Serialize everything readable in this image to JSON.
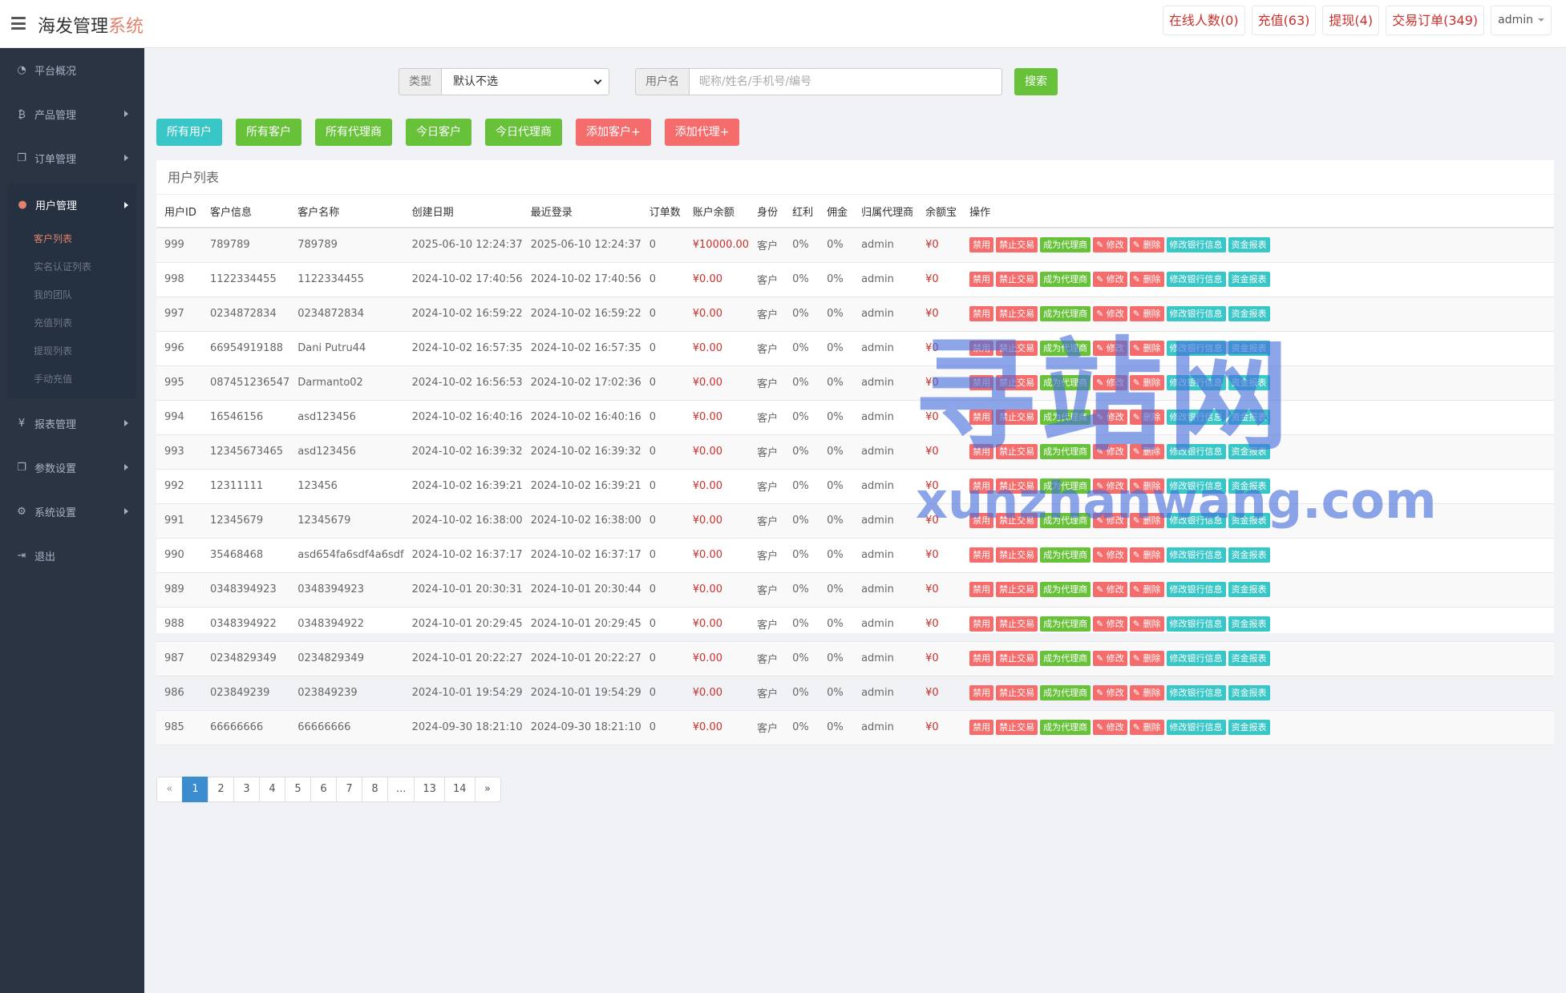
{
  "header": {
    "brand_main": "海发管理",
    "brand_accent": "系统",
    "pills": [
      "在线人数(0)",
      "充值(63)",
      "提现(4)",
      "交易订单(349)"
    ],
    "admin_label": "admin"
  },
  "sidebar": {
    "items": [
      {
        "label": "平台概况",
        "icon": "dashboard-icon",
        "glyph": "◔"
      },
      {
        "label": "产品管理",
        "icon": "bitcoin-icon",
        "glyph": "₿"
      },
      {
        "label": "订单管理",
        "icon": "copy-icon",
        "glyph": "❐"
      }
    ],
    "active": {
      "label": "用户管理",
      "icon": "user-icon",
      "glyph": "●"
    },
    "sub_items": [
      "客户列表",
      "实名认证列表",
      "我的团队",
      "充值列表",
      "提现列表",
      "手动充值"
    ],
    "items_after": [
      {
        "label": "报表管理",
        "icon": "yen-icon",
        "glyph": "¥"
      },
      {
        "label": "参数设置",
        "icon": "copy-icon",
        "glyph": "❐"
      },
      {
        "label": "系统设置",
        "icon": "gears-icon",
        "glyph": "⚙"
      },
      {
        "label": "退出",
        "icon": "sign-out-icon",
        "glyph": "⇥"
      }
    ]
  },
  "search": {
    "type_label": "类型",
    "type_value": "默认不选",
    "user_label": "用户名",
    "user_placeholder": "昵称/姓名/手机号/编号",
    "search_button": "搜索"
  },
  "filters": [
    {
      "label": "所有用户",
      "color": "teal"
    },
    {
      "label": "所有客户",
      "color": "green"
    },
    {
      "label": "所有代理商",
      "color": "green"
    },
    {
      "label": "今日客户",
      "color": "green"
    },
    {
      "label": "今日代理商",
      "color": "green"
    },
    {
      "label": "添加客户+",
      "color": "red"
    },
    {
      "label": "添加代理+",
      "color": "red"
    }
  ],
  "panel_title": "用户列表",
  "table": {
    "columns": [
      "用户ID",
      "客户信息",
      "客户名称",
      "创建日期",
      "最近登录",
      "订单数",
      "账户余额",
      "身份",
      "红利",
      "佣金",
      "归属代理商",
      "余额宝",
      "操作"
    ],
    "actions": [
      {
        "label": "禁用",
        "color": "red"
      },
      {
        "label": "禁止交易",
        "color": "red"
      },
      {
        "label": "成为代理商",
        "color": "green"
      },
      {
        "label": "✎ 修改",
        "color": "red"
      },
      {
        "label": "✎ 删除",
        "color": "red"
      },
      {
        "label": "修改银行信息",
        "color": "teal"
      },
      {
        "label": "资金报表",
        "color": "teal"
      }
    ],
    "rows": [
      [
        "999",
        "789789",
        "789789",
        "2025-06-10 12:24:37",
        "2025-06-10 12:24:37",
        "0",
        "¥10000.00",
        "客户",
        "0%",
        "0%",
        "admin",
        "¥0"
      ],
      [
        "998",
        "1122334455",
        "1122334455",
        "2024-10-02 17:40:56",
        "2024-10-02 17:40:56",
        "0",
        "¥0.00",
        "客户",
        "0%",
        "0%",
        "admin",
        "¥0"
      ],
      [
        "997",
        "0234872834",
        "0234872834",
        "2024-10-02 16:59:22",
        "2024-10-02 16:59:22",
        "0",
        "¥0.00",
        "客户",
        "0%",
        "0%",
        "admin",
        "¥0"
      ],
      [
        "996",
        "66954919188",
        "Dani Putru44",
        "2024-10-02 16:57:35",
        "2024-10-02 16:57:35",
        "0",
        "¥0.00",
        "客户",
        "0%",
        "0%",
        "admin",
        "¥0"
      ],
      [
        "995",
        "087451236547",
        "Darmanto02",
        "2024-10-02 16:56:53",
        "2024-10-02 17:02:36",
        "0",
        "¥0.00",
        "客户",
        "0%",
        "0%",
        "admin",
        "¥0"
      ],
      [
        "994",
        "16546156",
        "asd123456",
        "2024-10-02 16:40:16",
        "2024-10-02 16:40:16",
        "0",
        "¥0.00",
        "客户",
        "0%",
        "0%",
        "admin",
        "¥0"
      ],
      [
        "993",
        "12345673465",
        "asd123456",
        "2024-10-02 16:39:32",
        "2024-10-02 16:39:32",
        "0",
        "¥0.00",
        "客户",
        "0%",
        "0%",
        "admin",
        "¥0"
      ],
      [
        "992",
        "12311111",
        "123456",
        "2024-10-02 16:39:21",
        "2024-10-02 16:39:21",
        "0",
        "¥0.00",
        "客户",
        "0%",
        "0%",
        "admin",
        "¥0"
      ],
      [
        "991",
        "12345679",
        "12345679",
        "2024-10-02 16:38:00",
        "2024-10-02 16:38:00",
        "0",
        "¥0.00",
        "客户",
        "0%",
        "0%",
        "admin",
        "¥0"
      ],
      [
        "990",
        "35468468",
        "asd654fa6sdf4a6sdf",
        "2024-10-02 16:37:17",
        "2024-10-02 16:37:17",
        "0",
        "¥0.00",
        "客户",
        "0%",
        "0%",
        "admin",
        "¥0"
      ],
      [
        "989",
        "0348394923",
        "0348394923",
        "2024-10-01 20:30:31",
        "2024-10-01 20:30:44",
        "0",
        "¥0.00",
        "客户",
        "0%",
        "0%",
        "admin",
        "¥0"
      ],
      [
        "988",
        "0348394922",
        "0348394922",
        "2024-10-01 20:29:45",
        "2024-10-01 20:29:45",
        "0",
        "¥0.00",
        "客户",
        "0%",
        "0%",
        "admin",
        "¥0"
      ],
      [
        "987",
        "0234829349",
        "0234829349",
        "2024-10-01 20:22:27",
        "2024-10-01 20:22:27",
        "0",
        "¥0.00",
        "客户",
        "0%",
        "0%",
        "admin",
        "¥0"
      ],
      [
        "986",
        "023849239",
        "023849239",
        "2024-10-01 19:54:29",
        "2024-10-01 19:54:29",
        "0",
        "¥0.00",
        "客户",
        "0%",
        "0%",
        "admin",
        "¥0"
      ],
      [
        "985",
        "66666666",
        "66666666",
        "2024-09-30 18:21:10",
        "2024-09-30 18:21:10",
        "0",
        "¥0.00",
        "客户",
        "0%",
        "0%",
        "admin",
        "¥0"
      ]
    ]
  },
  "pagination": {
    "pages": [
      "«",
      "1",
      "2",
      "3",
      "4",
      "5",
      "6",
      "7",
      "8",
      "...",
      "13",
      "14",
      "»"
    ],
    "active": "1"
  },
  "watermark": {
    "big": "寻站网",
    "small": "xunzhanwang.com"
  }
}
